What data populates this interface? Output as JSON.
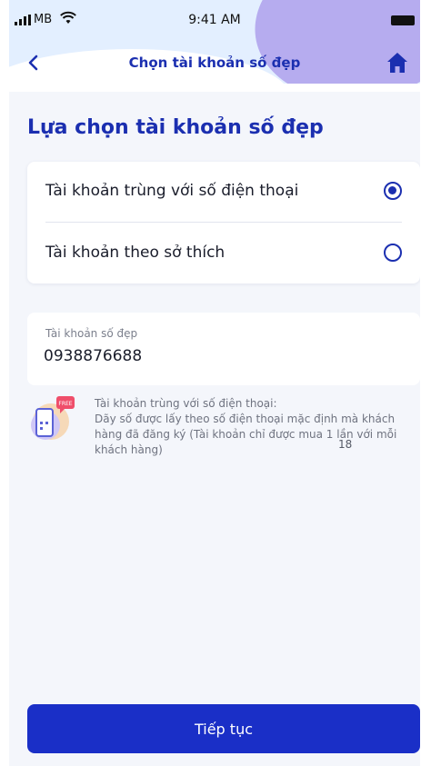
{
  "status_bar": {
    "carrier": "MB",
    "time": "9:41 AM"
  },
  "nav": {
    "title": "Chọn tài khoản số đẹp",
    "back_icon": "chevron-left-icon",
    "home_icon": "home-icon"
  },
  "page": {
    "heading": "Lựa chọn tài khoản số đẹp"
  },
  "options": [
    {
      "label": "Tài khoản trùng với số điện thoại",
      "selected": true
    },
    {
      "label": "Tài khoản theo sở thích",
      "selected": false
    }
  ],
  "account_field": {
    "label": "Tài khoản số đẹp",
    "value": "0938876688"
  },
  "info": {
    "badge": "FREE",
    "title": "Tài khoản trùng với số điện thoại:",
    "description": "Dãy số được lấy theo số điện thoại mặc định mà khách hàng đã đăng ký (Tài khoản chỉ được mua 1 lần với mỗi khách hàng)"
  },
  "page_number": "18",
  "cta_label": "Tiếp tục",
  "colors": {
    "primary": "#1b2fb0",
    "button": "#1a2fc7",
    "header_bg": "#e3efff",
    "accent_purple": "#b6acef",
    "background": "#f4f6fb"
  }
}
